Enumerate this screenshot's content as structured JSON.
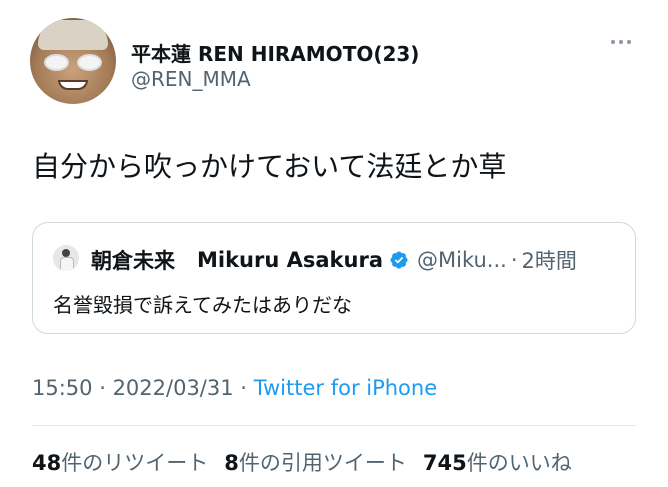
{
  "author": {
    "display_name": "平本蓮 REN HIRAMOTO(23)",
    "username": "@REN_MMA"
  },
  "tweet": {
    "text": "自分から吹っかけておいて法廷とか草"
  },
  "quote": {
    "name_jp": "朝倉未来",
    "name_en": "Mikuru Asakura",
    "handle": "@Miku...",
    "separator": "·",
    "time": "2時間",
    "text": "名誉毀損で訴えてみたはありだな"
  },
  "meta": {
    "time": "15:50",
    "sep1": " · ",
    "date": "2022/03/31",
    "sep2": " · ",
    "source": "Twitter for iPhone"
  },
  "stats": {
    "retweets_count": "48",
    "retweets_label": "件のリツイート",
    "quotes_count": "8",
    "quotes_label": "件の引用ツイート",
    "likes_count": "745",
    "likes_label": "件のいいね"
  },
  "colors": {
    "accent": "#1d9bf0",
    "secondary_text": "#536471",
    "border": "#cfd9de"
  },
  "icons": {
    "more": "more-horizontal-icon",
    "verified": "verified-badge-icon"
  }
}
